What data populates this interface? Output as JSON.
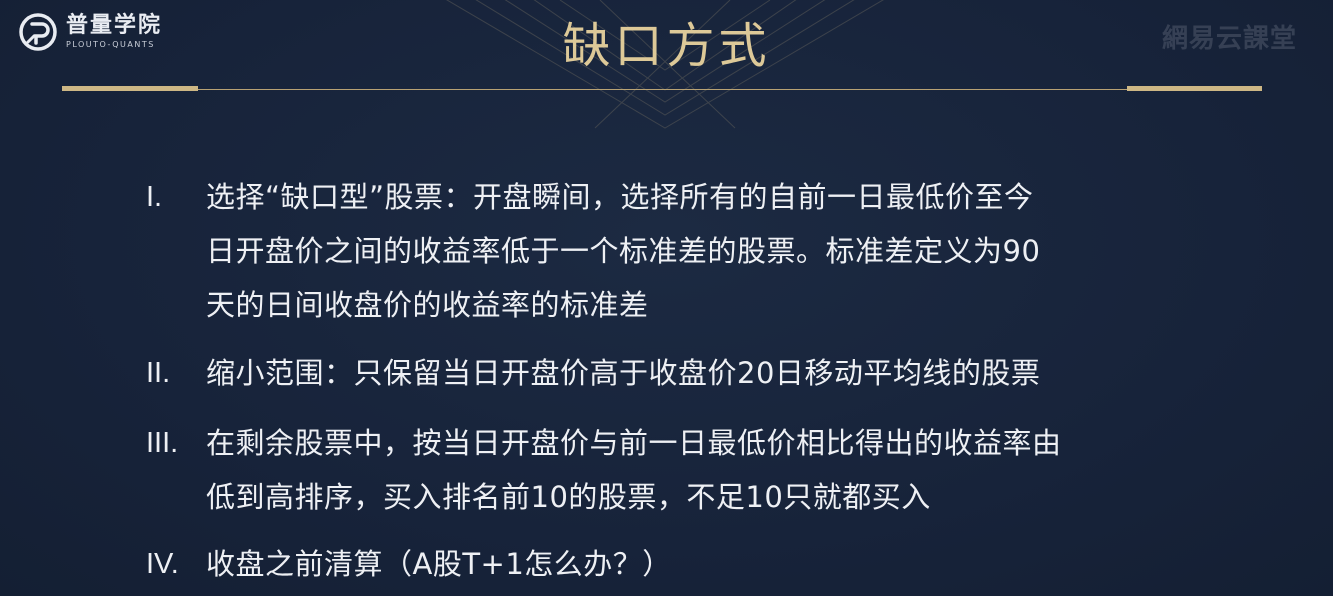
{
  "brand": {
    "name_cn": "普量学院",
    "name_en": "PLOUTO-QUANTS"
  },
  "watermark": "網易云課堂",
  "title": "缺口方式",
  "items": [
    {
      "num": "I.",
      "lines": [
        "选择“缺口型”股票：开盘瞬间，选择所有的自前一日最低价至今",
        "日开盘价之间的收益率低于一个标准差的股票。标准差定义为90",
        "天的日间收盘价的收益率的标准差"
      ]
    },
    {
      "num": "II.",
      "lines": [
        "缩小范围：只保留当日开盘价高于收盘价20日移动平均线的股票"
      ]
    },
    {
      "num": "III.",
      "lines": [
        "在剩余股票中，按当日开盘价与前一日最低价相比得出的收益率由",
        "低到高排序，买入排名前10的股票，不足10只就都买入"
      ]
    },
    {
      "num": "IV.",
      "lines": [
        "收盘之前清算（A股T+1怎么办？）"
      ]
    }
  ],
  "colors": {
    "background": "#18243a",
    "accent_gold": "#ddc998",
    "text": "#eef0f4"
  }
}
